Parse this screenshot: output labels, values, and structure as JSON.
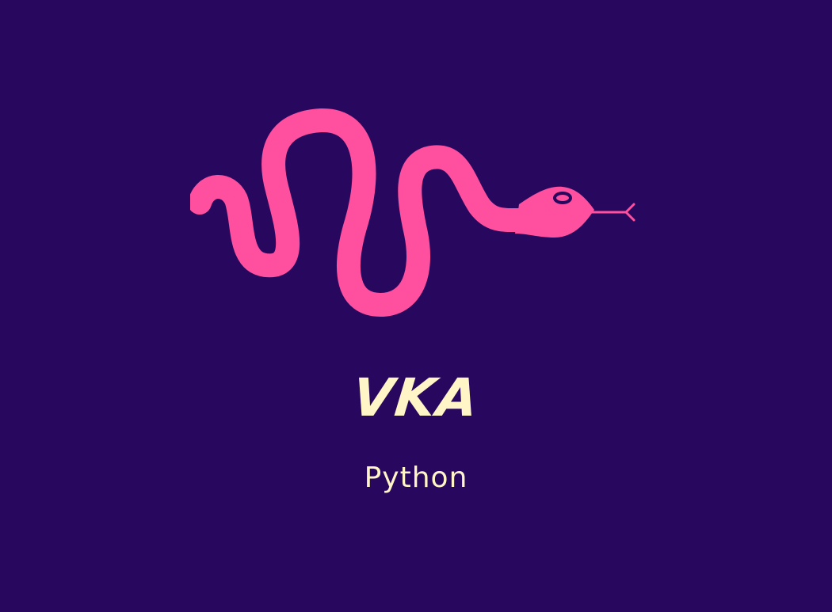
{
  "logo": {
    "title": "VKA",
    "subtitle": "Python",
    "icon": "snake-icon"
  },
  "colors": {
    "background": "#28085e",
    "snake": "#ff4f9f",
    "text": "#fff5c6"
  }
}
